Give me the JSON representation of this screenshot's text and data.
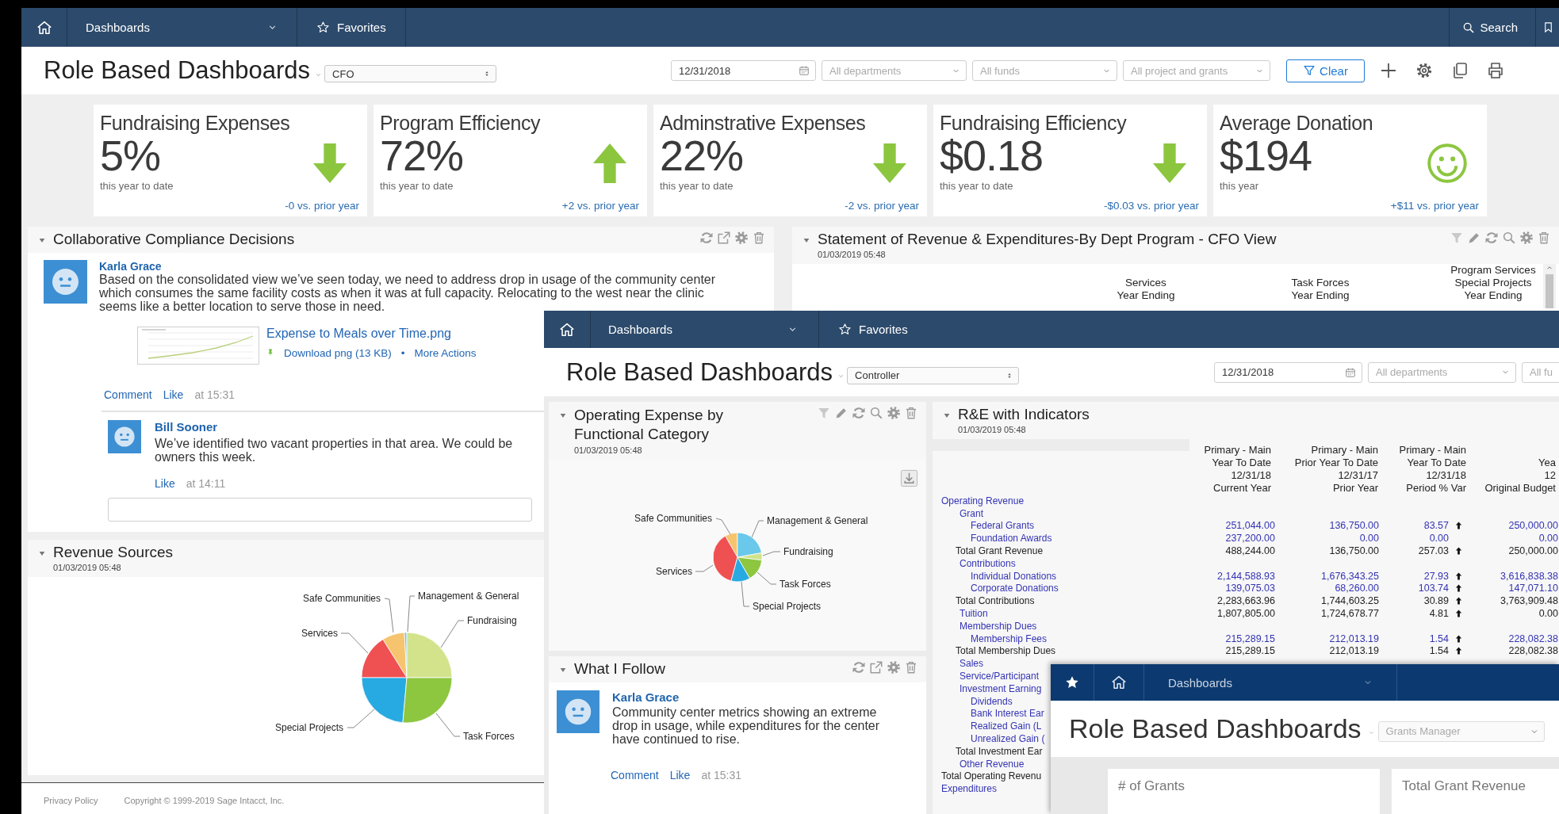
{
  "cfo_window": {
    "nav": {
      "menu": "Dashboards",
      "favorites": "Favorites",
      "search": "Search"
    },
    "header": {
      "title": "Role Based Dashboards",
      "role": "CFO",
      "date": "12/31/2018",
      "filters": [
        "All departments",
        "All funds",
        "All project and grants"
      ],
      "clear": "Clear"
    },
    "kpis": [
      {
        "title": "Fundraising Expenses",
        "value": "5%",
        "caption": "this year to date",
        "delta": "-0 vs. prior year",
        "kind": "down"
      },
      {
        "title": "Program Efficiency",
        "value": "72%",
        "caption": "this year to date",
        "delta": "+2 vs. prior year",
        "kind": "up"
      },
      {
        "title": "Adminstrative Expenses",
        "value": "22%",
        "caption": "this year to date",
        "delta": "-2 vs. prior year",
        "kind": "down"
      },
      {
        "title": "Fundraising Efficiency",
        "value": "$0.18",
        "caption": "this year to date",
        "delta": "-$0.03 vs. prior year",
        "kind": "down"
      },
      {
        "title": "Average Donation",
        "value": "$194",
        "caption": "this year",
        "delta": "+$11 vs. prior year",
        "kind": "smiley"
      }
    ],
    "compliance_panel": {
      "title": "Collaborative Compliance Decisions",
      "post": {
        "author": "Karla Grace",
        "lines": [
          "Based on the consolidated view we’ve seen today, we need to address drop in usage of the community center",
          "which consumes the same facility costs as when it was at full capacity. Relocating to the west near the clinic",
          "seems like a better location to serve those in need."
        ],
        "attachment": {
          "name": "Expense to Meals over Time.png",
          "download": "Download png (13 KB)",
          "separator": "•",
          "more": "More Actions"
        },
        "actions": [
          "Comment",
          "Like"
        ],
        "time": "at 15:31",
        "reply": {
          "author": "Bill Sooner",
          "lines": [
            "We’ve identified two vacant properties in that area. We could be",
            "owners this week."
          ],
          "actions": [
            "Like"
          ],
          "time": "at 14:11"
        }
      }
    },
    "statement_panel": {
      "title": "Statement of Revenue & Expenditures-By Dept Program - CFO View",
      "timestamp": "01/03/2019 05:48",
      "columns": [
        [
          "Services",
          "Year Ending"
        ],
        [
          "Task Forces",
          "Year Ending"
        ],
        [
          "Program Services",
          "Special Projects",
          "Year Ending"
        ]
      ]
    },
    "revenue_panel": {
      "title": "Revenue Sources",
      "timestamp": "01/03/2019 05:48",
      "slices": [
        {
          "label": "Safe Communities",
          "color": "#f6c46e"
        },
        {
          "label": "Management & General",
          "color": "#66c3e6"
        },
        {
          "label": "Fundraising",
          "color": "#d2e38c"
        },
        {
          "label": "Services",
          "color": "#ef5052"
        },
        {
          "label": "Special Projects",
          "color": "#27aae1"
        },
        {
          "label": "Task Forces",
          "color": "#8dc63f"
        }
      ]
    },
    "footer": {
      "privacy": "Privacy Policy",
      "copyright": "Copyright © 1999-2019 Sage Intacct, Inc."
    }
  },
  "controller_window": {
    "nav": {
      "menu": "Dashboards",
      "favorites": "Favorites"
    },
    "header": {
      "title": "Role Based Dashboards",
      "role": "Controller",
      "date": "12/31/2018",
      "filters": [
        "All departments",
        "All fu"
      ]
    },
    "expense_panel": {
      "title": "Operating Expense by Functional Category",
      "timestamp": "01/03/2019 05:48",
      "slices": [
        {
          "label": "Safe Communities",
          "color": "#f6c46e"
        },
        {
          "label": "Management & General",
          "color": "#6ac8ea"
        },
        {
          "label": "Fundraising",
          "color": "#cfe38a"
        },
        {
          "label": "Services",
          "color": "#ef5052"
        },
        {
          "label": "Task Forces",
          "color": "#8dc63f"
        },
        {
          "label": "Special Projects",
          "color": "#27aae1"
        }
      ]
    },
    "follow_panel": {
      "title": "What I Follow",
      "post": {
        "author": "Karla Grace",
        "lines": [
          "Community center metrics showing an extreme",
          "drop in usage, while expenditures for the center",
          "have continued to rise."
        ],
        "actions": [
          "Comment",
          "Like"
        ],
        "time": "at 15:31"
      }
    },
    "re_panel": {
      "title": "R&E with Indicators",
      "timestamp": "01/03/2019 05:48",
      "columns": [
        [
          "Primary - Main",
          "Year To Date",
          "12/31/18",
          "Current Year"
        ],
        [
          "Primary - Main",
          "Prior Year To Date",
          "12/31/17",
          "Prior Year"
        ],
        [
          "Primary - Main",
          "Year To Date",
          "12/31/18",
          "Period % Var"
        ],
        [
          "Yea",
          "12",
          "Original Budget"
        ]
      ],
      "rows": [
        {
          "label": "Operating Revenue",
          "kind": "link",
          "children": [
            {
              "label": "Grant",
              "kind": "link",
              "children": [
                {
                  "label": "Federal Grants",
                  "kind": "link",
                  "values": [
                    "251,044.00",
                    "136,750.00",
                    "83.57",
                    "250,000.00"
                  ],
                  "arrow": true,
                  "drill": true
                },
                {
                  "label": "Foundation Awards",
                  "kind": "link",
                  "values": [
                    "237,200.00",
                    "0.00",
                    "0.00",
                    "0.00"
                  ],
                  "arrow": false,
                  "drill": true
                }
              ]
            },
            {
              "label": "Total Grant Revenue",
              "kind": "total",
              "values": [
                "488,244.00",
                "136,750.00",
                "257.03",
                "250,000.00"
              ],
              "arrow": true,
              "drill": false
            },
            {
              "label": "Contributions",
              "kind": "link",
              "children": [
                {
                  "label": "Individual Donations",
                  "kind": "link",
                  "values": [
                    "2,144,588.93",
                    "1,676,343.25",
                    "27.93",
                    "3,616,838.38"
                  ],
                  "arrow": true,
                  "drill": true
                },
                {
                  "label": "Corporate Donations",
                  "kind": "link",
                  "values": [
                    "139,075.03",
                    "68,260.00",
                    "103.74",
                    "147,071.10"
                  ],
                  "arrow": true,
                  "drill": true
                }
              ]
            },
            {
              "label": "Total Contributions",
              "kind": "total",
              "values": [
                "2,283,663.96",
                "1,744,603.25",
                "30.89",
                "3,763,909.48"
              ],
              "arrow": true,
              "drill": false
            },
            {
              "label": "Tuition",
              "kind": "link",
              "values": [
                "1,807,805.00",
                "1,724,678.77",
                "4.81",
                "0.00"
              ],
              "arrow": true,
              "drill": false
            },
            {
              "label": "Membership Dues",
              "kind": "link",
              "children": [
                {
                  "label": "Membership Fees",
                  "kind": "link",
                  "values": [
                    "215,289.15",
                    "212,013.19",
                    "1.54",
                    "228,082.38"
                  ],
                  "arrow": true,
                  "drill": true
                }
              ]
            },
            {
              "label": "Total Membership Dues",
              "kind": "total",
              "values": [
                "215,289.15",
                "212,013.19",
                "1.54",
                "228,082.38"
              ],
              "arrow": true,
              "drill": false
            },
            {
              "label": "Sales",
              "kind": "link"
            },
            {
              "label": "Service/Participant",
              "kind": "link"
            },
            {
              "label": "Investment Earning",
              "kind": "link",
              "children": [
                {
                  "label": "Dividends",
                  "kind": "link"
                },
                {
                  "label": "Bank Interest Ear",
                  "kind": "link"
                },
                {
                  "label": "Realized Gain (L",
                  "kind": "link"
                },
                {
                  "label": "Unrealized Gain (",
                  "kind": "link"
                }
              ]
            },
            {
              "label": "Total Investment Ear",
              "kind": "total"
            },
            {
              "label": "Other Revenue",
              "kind": "link"
            }
          ]
        },
        {
          "label": "Total Operating Revenu",
          "kind": "total"
        },
        {
          "label": "Expenditures",
          "kind": "link"
        }
      ]
    }
  },
  "grants_window": {
    "nav": {
      "menu": "Dashboards"
    },
    "header": {
      "title": "Role Based Dashboards",
      "role": "Grants Manager"
    },
    "cards": [
      "# of Grants",
      "Total Grant Revenue"
    ]
  }
}
